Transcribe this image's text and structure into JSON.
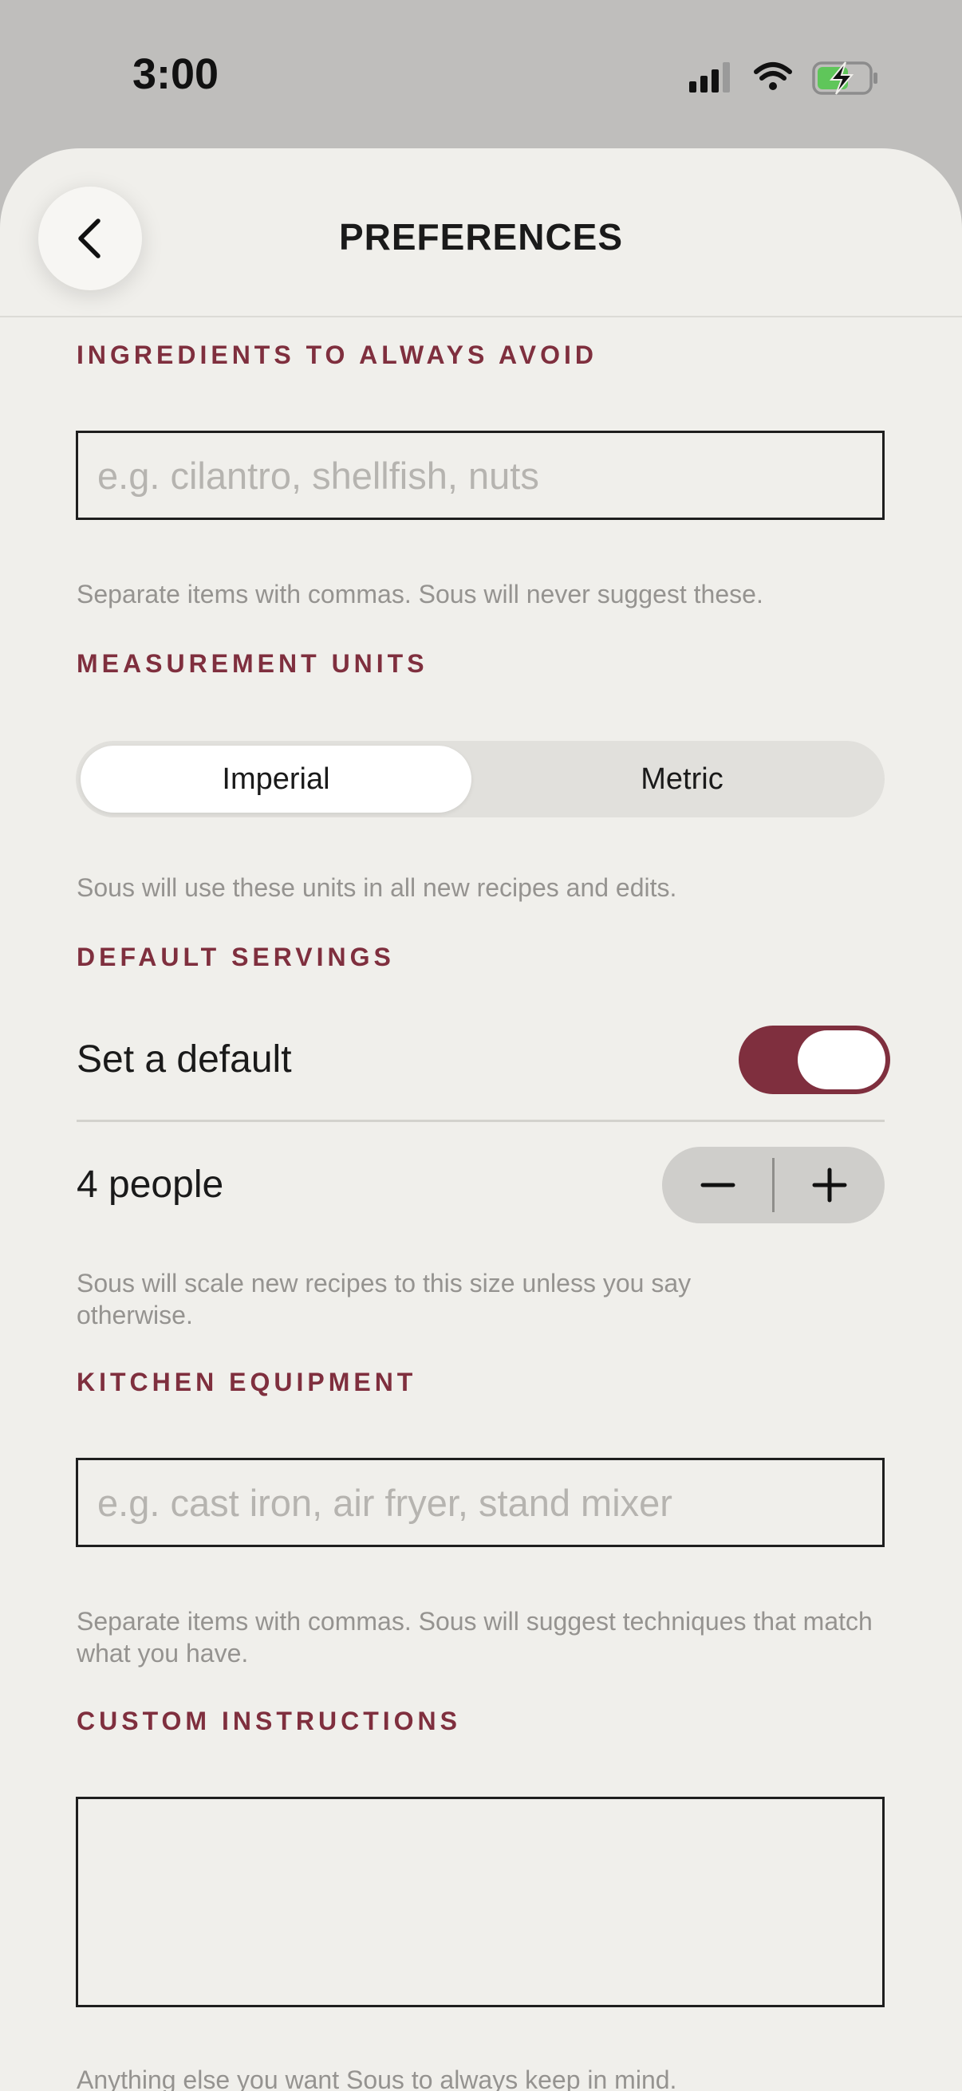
{
  "status_bar": {
    "time": "3:00",
    "icons": [
      "cellular-signal-icon",
      "wifi-icon",
      "battery-charging-icon"
    ]
  },
  "header": {
    "title": "PREFERENCES",
    "back_icon": "chevron-left-icon"
  },
  "sections": {
    "avoid": {
      "label": "INGREDIENTS TO ALWAYS AVOID",
      "placeholder": "e.g. cilantro, shellfish, nuts",
      "value": "",
      "hint": "Separate items with commas. Sous will never suggest these."
    },
    "units": {
      "label": "MEASUREMENT UNITS",
      "options": [
        "Imperial",
        "Metric"
      ],
      "selected": "Imperial",
      "hint": "Sous will use these units in all new recipes and edits."
    },
    "servings": {
      "label": "DEFAULT SERVINGS",
      "toggle_label": "Set a default",
      "toggle_on": true,
      "count_label": "4 people",
      "decrement_icon": "minus-icon",
      "increment_icon": "plus-icon",
      "hint": "Sous will scale new recipes to this size unless you say otherwise."
    },
    "equipment": {
      "label": "KITCHEN EQUIPMENT",
      "placeholder": "e.g. cast iron, air fryer, stand mixer",
      "value": "",
      "hint": "Separate items with commas. Sous will suggest techniques that match what you have."
    },
    "instructions": {
      "label": "CUSTOM INSTRUCTIONS",
      "value": "",
      "hint": "Anything else you want Sous to always keep in mind."
    }
  },
  "colors": {
    "accent": "#7f2f3e",
    "sheet_background": "#f0efeb",
    "status_background": "#bfbebc",
    "hint_text": "#959390",
    "battery_fill": "#5fc65a"
  }
}
